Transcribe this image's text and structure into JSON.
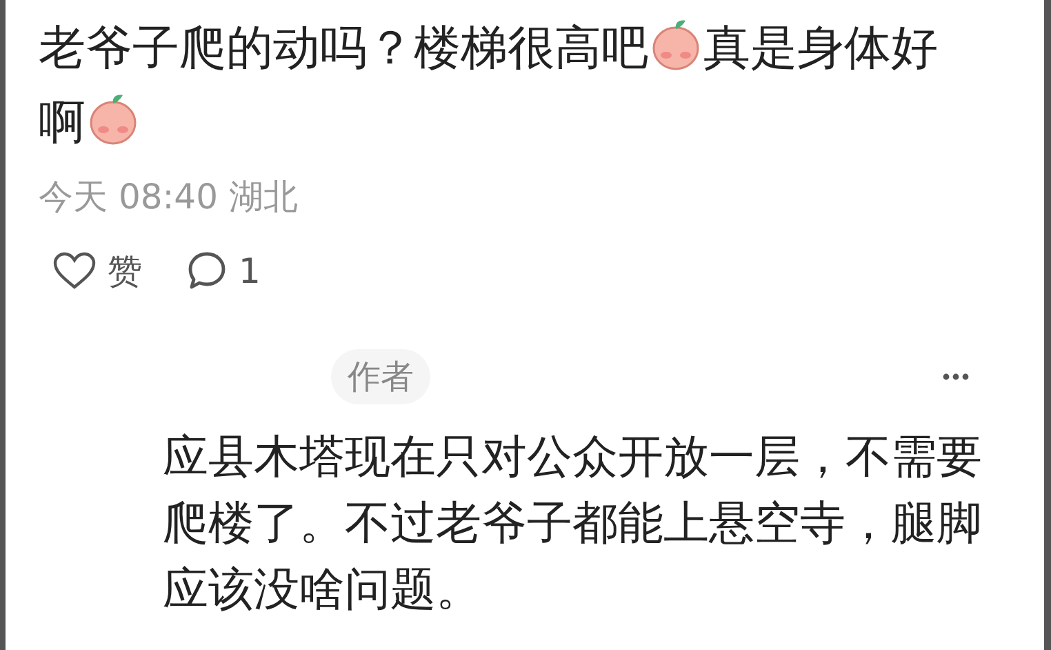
{
  "comment": {
    "segments": [
      {
        "kind": "text",
        "text": "老爷子爬的动吗？楼梯很高吧"
      },
      {
        "kind": "emoji"
      },
      {
        "kind": "text",
        "text": "真是身体好"
      },
      {
        "kind": "text",
        "text": "啊"
      },
      {
        "kind": "emoji"
      }
    ],
    "meta": "今天 08:40 湖北",
    "like": {
      "label": "赞",
      "liked": false
    },
    "reply_count": "1"
  },
  "reply": {
    "badge": "作者",
    "text": "应县木塔现在只对公众开放一层，不需要爬楼了。不过老爷子都能上悬空寺，腿脚应该没啥问题。"
  }
}
